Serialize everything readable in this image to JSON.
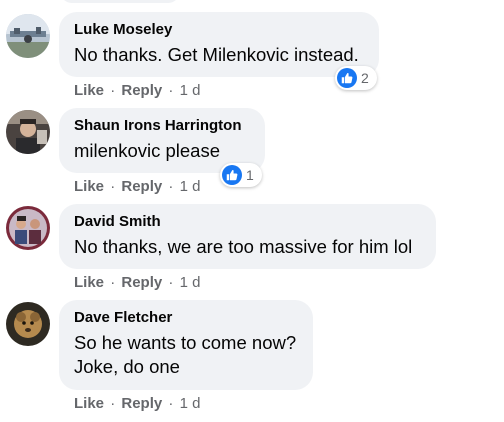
{
  "comments": [
    {
      "author": "Luke Moseley",
      "lines": [
        "No thanks. Get Milenkovic instead."
      ],
      "like_label": "Like",
      "reply_label": "Reply",
      "time": "1 d",
      "reaction_count": "2"
    },
    {
      "author": "Shaun Irons Harrington",
      "lines": [
        "milenkovic please"
      ],
      "like_label": "Like",
      "reply_label": "Reply",
      "time": "1 d",
      "reaction_count": "1"
    },
    {
      "author": "David Smith",
      "lines": [
        "No thanks, we are too massive for him lol"
      ],
      "like_label": "Like",
      "reply_label": "Reply",
      "time": "1 d"
    },
    {
      "author": "Dave Fletcher",
      "lines": [
        "So he wants to come now?",
        "Joke, do one"
      ],
      "like_label": "Like",
      "reply_label": "Reply",
      "time": "1 d"
    }
  ],
  "colors": {
    "bubble": "#f0f2f5",
    "text": "#050505",
    "secondary": "#65676b",
    "like_blue": "#1877f2"
  },
  "icons": {
    "reaction": "thumbs-up-icon"
  }
}
